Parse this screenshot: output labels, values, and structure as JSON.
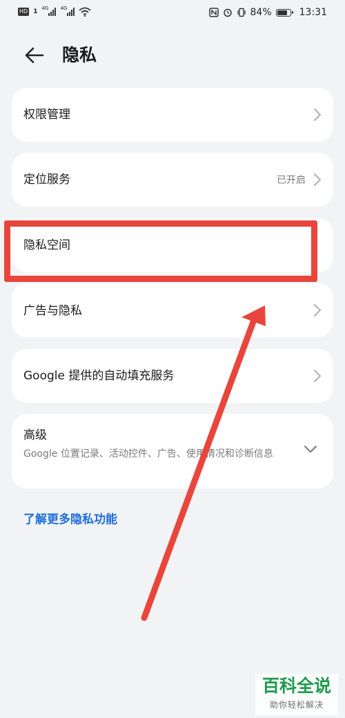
{
  "status_bar": {
    "left_badge": "HD",
    "left_badge_num": "1",
    "network_1": "4G",
    "network_2": "4G",
    "battery_percent": "84%",
    "battery_level": 0.84,
    "time": "13:31"
  },
  "header": {
    "title": "隐私"
  },
  "menu": {
    "permission": {
      "label": "权限管理"
    },
    "location": {
      "label": "定位服务",
      "value": "已开启"
    },
    "private_space": {
      "label": "隐私空间"
    },
    "ads": {
      "label": "广告与隐私"
    },
    "google_autofill": {
      "label": "Google 提供的自动填充服务"
    },
    "advanced": {
      "label": "高级",
      "description": "Google 位置记录、活动控件、广告、使用情况和诊断信息"
    }
  },
  "link": {
    "label": "了解更多隐私功能"
  },
  "colors": {
    "link": "#1e6fd9",
    "highlight": "#e8463c",
    "watermark": "#1f9a4c"
  },
  "watermark": {
    "title": "百科全说",
    "subtitle": "助你轻松解决"
  }
}
